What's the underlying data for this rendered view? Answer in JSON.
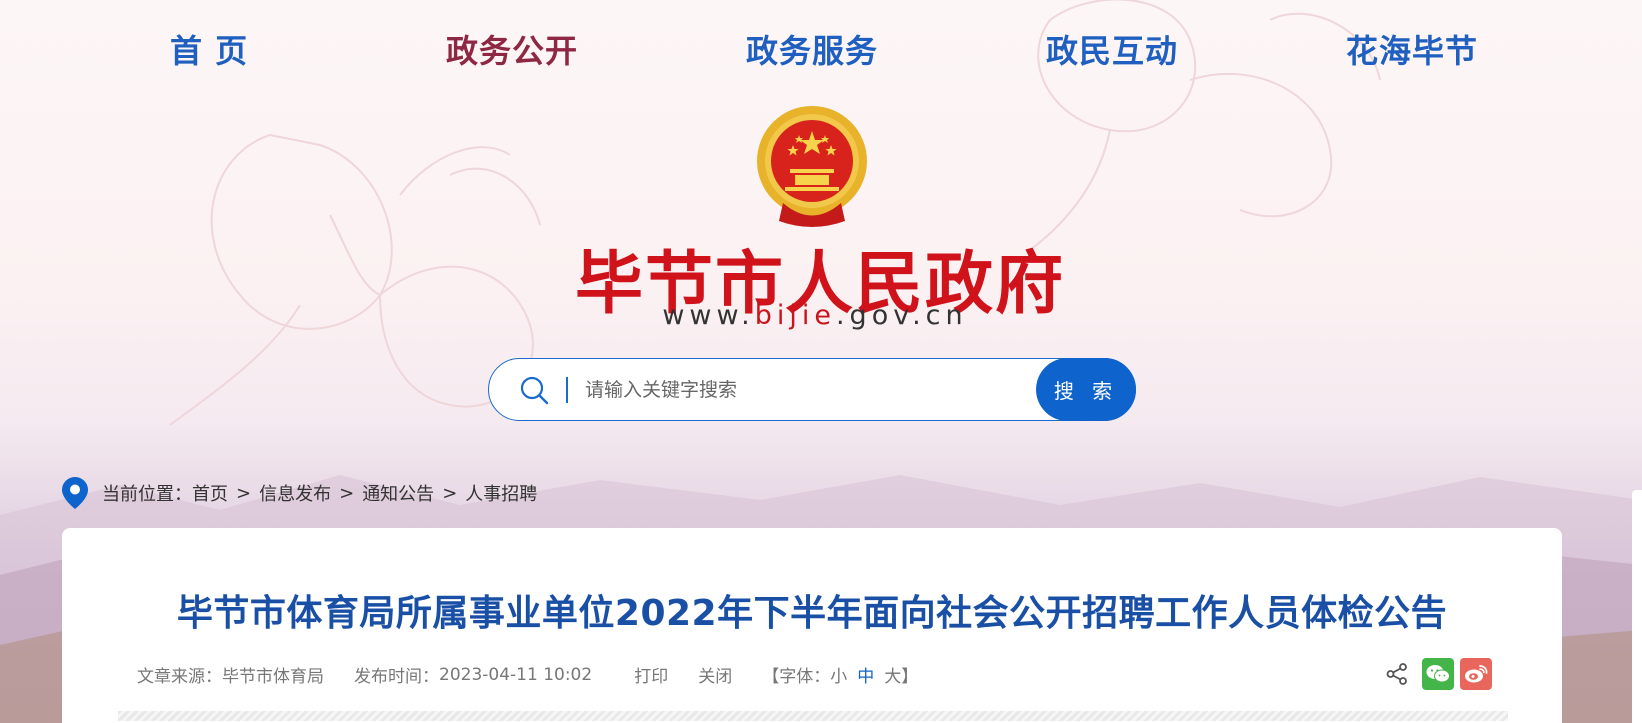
{
  "nav": {
    "items": [
      {
        "label": "首  页"
      },
      {
        "label": "政务公开"
      },
      {
        "label": "政务服务"
      },
      {
        "label": "政民互动"
      },
      {
        "label": "花海毕节"
      }
    ],
    "active_index": 1
  },
  "header": {
    "site_title": "毕节市人民政府",
    "url_prefix": "www.",
    "url_highlight": "bijie",
    "url_suffix": ".gov.cn"
  },
  "search": {
    "placeholder": "请输入关键字搜索",
    "button_label": "搜 索"
  },
  "breadcrumb": {
    "prefix": "当前位置：",
    "items": [
      "首页",
      "信息发布",
      "通知公告",
      "人事招聘"
    ],
    "separator": ">"
  },
  "article": {
    "title": "毕节市体育局所属事业单位2022年下半年面向社会公开招聘工作人员体检公告",
    "source_label": "文章来源：",
    "source_value": "毕节市体育局",
    "publish_label": "发布时间：",
    "publish_value": "2023-04-11 10:02",
    "print_label": "打印",
    "close_label": "关闭",
    "font_open": "【字体：",
    "font_small": "小",
    "font_medium": "中",
    "font_large": "大",
    "font_close": "】"
  },
  "colors": {
    "nav_blue": "#1f5fbf",
    "nav_active": "#8d2742",
    "title_red": "#d0121b",
    "search_blue": "#0f63cc",
    "article_title": "#1a4fa6"
  }
}
